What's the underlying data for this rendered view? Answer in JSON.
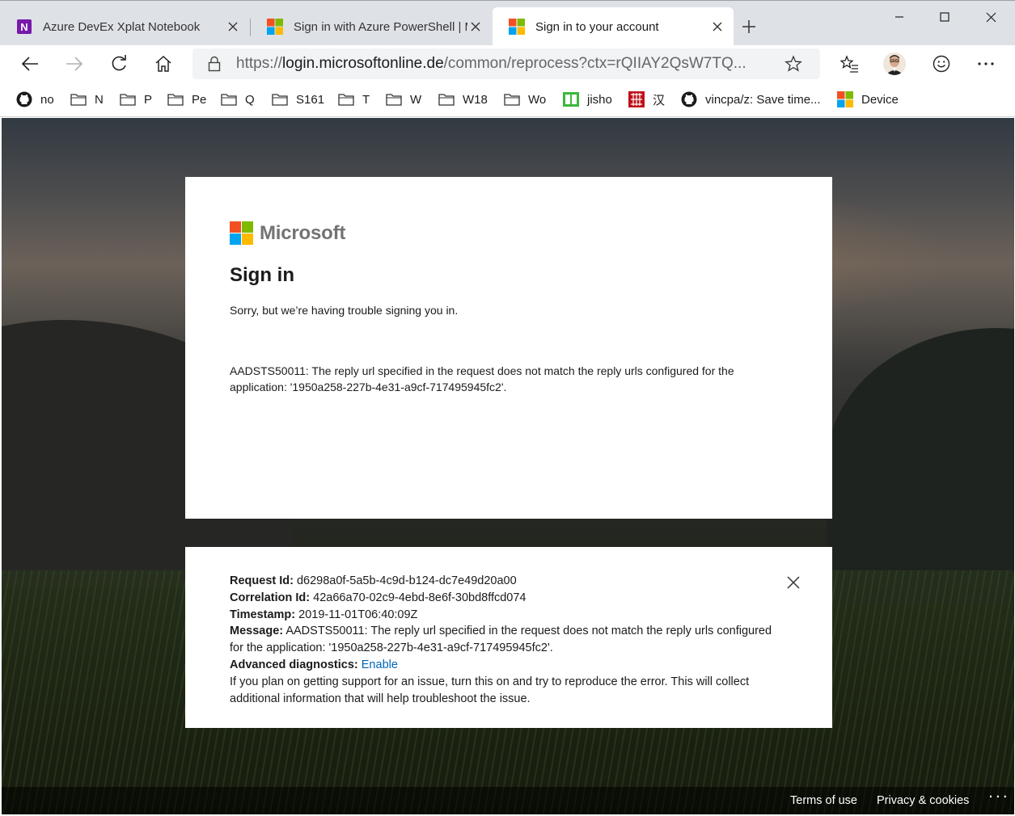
{
  "tabs": [
    {
      "title": "Azure DevEx Xplat Notebook",
      "favicon": "onenote-icon",
      "active": false
    },
    {
      "title": "Sign in with Azure PowerShell | M",
      "favicon": "microsoft-logo-icon",
      "active": false
    },
    {
      "title": "Sign in to your account",
      "favicon": "microsoft-logo-icon",
      "active": true
    }
  ],
  "address_bar": {
    "url_prefix": "https://",
    "url_host": "login.microsoftonline.de",
    "url_path": "/common/reprocess?ctx=rQIIAY2QsW7TQ..."
  },
  "bookmarks": [
    {
      "label": "no",
      "icon": "github-icon"
    },
    {
      "label": "N",
      "icon": "folder-icon"
    },
    {
      "label": "P",
      "icon": "folder-icon"
    },
    {
      "label": "Pe",
      "icon": "folder-icon"
    },
    {
      "label": "Q",
      "icon": "folder-icon"
    },
    {
      "label": "S161",
      "icon": "folder-icon"
    },
    {
      "label": "T",
      "icon": "folder-icon"
    },
    {
      "label": "W",
      "icon": "folder-icon"
    },
    {
      "label": "W18",
      "icon": "folder-icon"
    },
    {
      "label": "Wo",
      "icon": "folder-icon"
    },
    {
      "label": "jisho",
      "icon": "jisho-icon"
    },
    {
      "label": "汉",
      "icon": "hanzi-icon"
    },
    {
      "label": "vincpa/z: Save time...",
      "icon": "github-icon"
    },
    {
      "label": "Device",
      "icon": "microsoft-logo-icon"
    }
  ],
  "signin": {
    "brand": "Microsoft",
    "heading": "Sign in",
    "subtext": "Sorry, but we’re having trouble signing you in.",
    "error": "AADSTS50011: The reply url specified in the request does not match the reply urls configured for the application: '1950a258-227b-4e31-a9cf-717495945fc2'."
  },
  "details": {
    "request_id_label": "Request Id:",
    "request_id": "d6298a0f-5a5b-4c9d-b124-dc7e49d20a00",
    "correlation_id_label": "Correlation Id:",
    "correlation_id": "42a66a70-02c9-4ebd-8e6f-30bd8ffcd074",
    "timestamp_label": "Timestamp:",
    "timestamp": "2019-11-01T06:40:09Z",
    "message_label": "Message:",
    "message": "AADSTS50011: The reply url specified in the request does not match the reply urls configured for the application: '1950a258-227b-4e31-a9cf-717495945fc2'.",
    "advanced_label": "Advanced diagnostics:",
    "enable_link": "Enable",
    "help": "If you plan on getting support for an issue, turn this on and try to reproduce the error. This will collect additional information that will help troubleshoot the issue."
  },
  "footer": {
    "terms": "Terms of use",
    "privacy": "Privacy & cookies",
    "more": "· · ·"
  },
  "colors": {
    "ms_red": "#f25022",
    "ms_green": "#7fba00",
    "ms_blue": "#00a4ef",
    "ms_yellow": "#ffb900",
    "link_blue": "#0067b8"
  }
}
